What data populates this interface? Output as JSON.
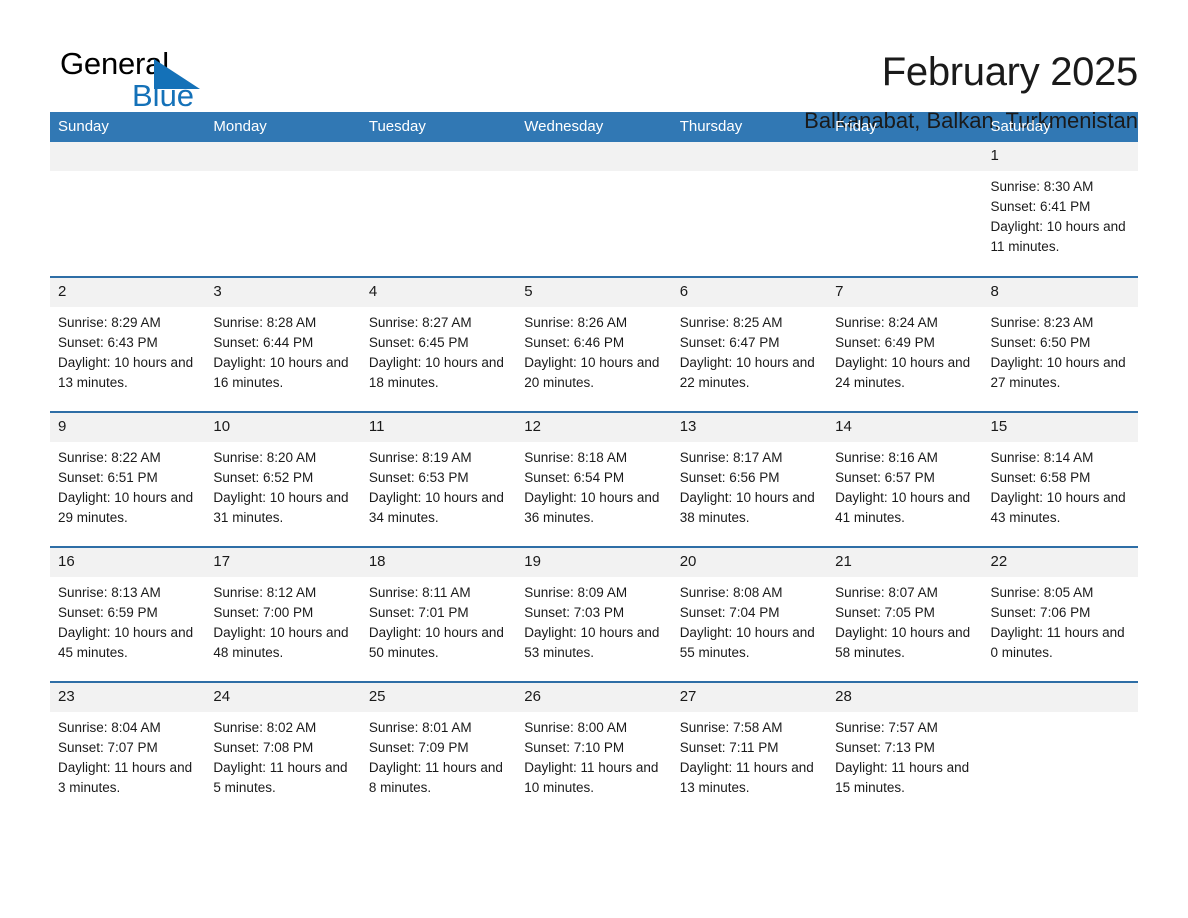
{
  "brand": {
    "line1": "General",
    "line2": "Blue",
    "triangle_color": "#1471b8",
    "text_color": "#000000"
  },
  "header": {
    "title": "February 2025",
    "subtitle": "Balkanabat, Balkan, Turkmenistan"
  },
  "colors": {
    "header_row_bg": "#3178b4",
    "row_divider": "#2e6ea6",
    "daynum_bg": "#f2f2f2",
    "text": "#1a1a1a"
  },
  "calendar": {
    "day_headers": [
      "Sunday",
      "Monday",
      "Tuesday",
      "Wednesday",
      "Thursday",
      "Friday",
      "Saturday"
    ],
    "weeks": [
      [
        {
          "day": "",
          "empty": true
        },
        {
          "day": "",
          "empty": true
        },
        {
          "day": "",
          "empty": true
        },
        {
          "day": "",
          "empty": true
        },
        {
          "day": "",
          "empty": true
        },
        {
          "day": "",
          "empty": true
        },
        {
          "day": "1",
          "sunrise": "Sunrise: 8:30 AM",
          "sunset": "Sunset: 6:41 PM",
          "daylight": "Daylight: 10 hours and 11 minutes."
        }
      ],
      [
        {
          "day": "2",
          "sunrise": "Sunrise: 8:29 AM",
          "sunset": "Sunset: 6:43 PM",
          "daylight": "Daylight: 10 hours and 13 minutes."
        },
        {
          "day": "3",
          "sunrise": "Sunrise: 8:28 AM",
          "sunset": "Sunset: 6:44 PM",
          "daylight": "Daylight: 10 hours and 16 minutes."
        },
        {
          "day": "4",
          "sunrise": "Sunrise: 8:27 AM",
          "sunset": "Sunset: 6:45 PM",
          "daylight": "Daylight: 10 hours and 18 minutes."
        },
        {
          "day": "5",
          "sunrise": "Sunrise: 8:26 AM",
          "sunset": "Sunset: 6:46 PM",
          "daylight": "Daylight: 10 hours and 20 minutes."
        },
        {
          "day": "6",
          "sunrise": "Sunrise: 8:25 AM",
          "sunset": "Sunset: 6:47 PM",
          "daylight": "Daylight: 10 hours and 22 minutes."
        },
        {
          "day": "7",
          "sunrise": "Sunrise: 8:24 AM",
          "sunset": "Sunset: 6:49 PM",
          "daylight": "Daylight: 10 hours and 24 minutes."
        },
        {
          "day": "8",
          "sunrise": "Sunrise: 8:23 AM",
          "sunset": "Sunset: 6:50 PM",
          "daylight": "Daylight: 10 hours and 27 minutes."
        }
      ],
      [
        {
          "day": "9",
          "sunrise": "Sunrise: 8:22 AM",
          "sunset": "Sunset: 6:51 PM",
          "daylight": "Daylight: 10 hours and 29 minutes."
        },
        {
          "day": "10",
          "sunrise": "Sunrise: 8:20 AM",
          "sunset": "Sunset: 6:52 PM",
          "daylight": "Daylight: 10 hours and 31 minutes."
        },
        {
          "day": "11",
          "sunrise": "Sunrise: 8:19 AM",
          "sunset": "Sunset: 6:53 PM",
          "daylight": "Daylight: 10 hours and 34 minutes."
        },
        {
          "day": "12",
          "sunrise": "Sunrise: 8:18 AM",
          "sunset": "Sunset: 6:54 PM",
          "daylight": "Daylight: 10 hours and 36 minutes."
        },
        {
          "day": "13",
          "sunrise": "Sunrise: 8:17 AM",
          "sunset": "Sunset: 6:56 PM",
          "daylight": "Daylight: 10 hours and 38 minutes."
        },
        {
          "day": "14",
          "sunrise": "Sunrise: 8:16 AM",
          "sunset": "Sunset: 6:57 PM",
          "daylight": "Daylight: 10 hours and 41 minutes."
        },
        {
          "day": "15",
          "sunrise": "Sunrise: 8:14 AM",
          "sunset": "Sunset: 6:58 PM",
          "daylight": "Daylight: 10 hours and 43 minutes."
        }
      ],
      [
        {
          "day": "16",
          "sunrise": "Sunrise: 8:13 AM",
          "sunset": "Sunset: 6:59 PM",
          "daylight": "Daylight: 10 hours and 45 minutes."
        },
        {
          "day": "17",
          "sunrise": "Sunrise: 8:12 AM",
          "sunset": "Sunset: 7:00 PM",
          "daylight": "Daylight: 10 hours and 48 minutes."
        },
        {
          "day": "18",
          "sunrise": "Sunrise: 8:11 AM",
          "sunset": "Sunset: 7:01 PM",
          "daylight": "Daylight: 10 hours and 50 minutes."
        },
        {
          "day": "19",
          "sunrise": "Sunrise: 8:09 AM",
          "sunset": "Sunset: 7:03 PM",
          "daylight": "Daylight: 10 hours and 53 minutes."
        },
        {
          "day": "20",
          "sunrise": "Sunrise: 8:08 AM",
          "sunset": "Sunset: 7:04 PM",
          "daylight": "Daylight: 10 hours and 55 minutes."
        },
        {
          "day": "21",
          "sunrise": "Sunrise: 8:07 AM",
          "sunset": "Sunset: 7:05 PM",
          "daylight": "Daylight: 10 hours and 58 minutes."
        },
        {
          "day": "22",
          "sunrise": "Sunrise: 8:05 AM",
          "sunset": "Sunset: 7:06 PM",
          "daylight": "Daylight: 11 hours and 0 minutes."
        }
      ],
      [
        {
          "day": "23",
          "sunrise": "Sunrise: 8:04 AM",
          "sunset": "Sunset: 7:07 PM",
          "daylight": "Daylight: 11 hours and 3 minutes."
        },
        {
          "day": "24",
          "sunrise": "Sunrise: 8:02 AM",
          "sunset": "Sunset: 7:08 PM",
          "daylight": "Daylight: 11 hours and 5 minutes."
        },
        {
          "day": "25",
          "sunrise": "Sunrise: 8:01 AM",
          "sunset": "Sunset: 7:09 PM",
          "daylight": "Daylight: 11 hours and 8 minutes."
        },
        {
          "day": "26",
          "sunrise": "Sunrise: 8:00 AM",
          "sunset": "Sunset: 7:10 PM",
          "daylight": "Daylight: 11 hours and 10 minutes."
        },
        {
          "day": "27",
          "sunrise": "Sunrise: 7:58 AM",
          "sunset": "Sunset: 7:11 PM",
          "daylight": "Daylight: 11 hours and 13 minutes."
        },
        {
          "day": "28",
          "sunrise": "Sunrise: 7:57 AM",
          "sunset": "Sunset: 7:13 PM",
          "daylight": "Daylight: 11 hours and 15 minutes."
        },
        {
          "day": "",
          "empty": true
        }
      ]
    ]
  }
}
